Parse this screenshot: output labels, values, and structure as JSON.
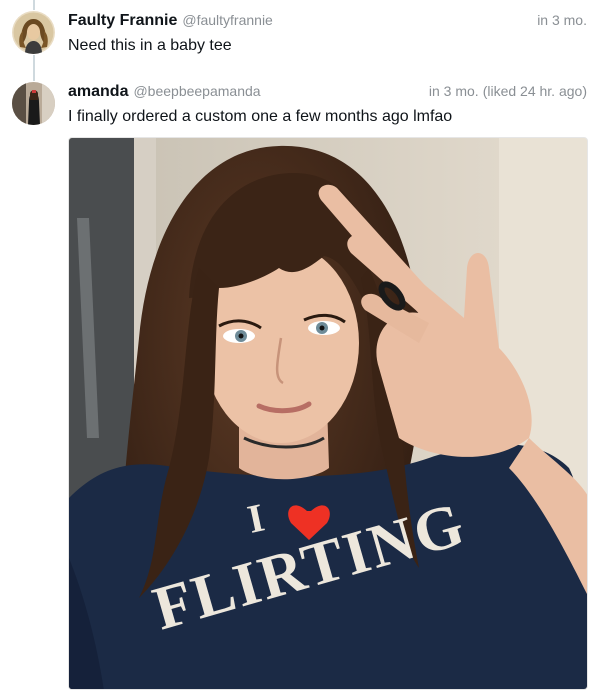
{
  "posts": [
    {
      "display_name": "Faulty Frannie",
      "handle": "@faultyfrannie",
      "time": "in 3 mo.",
      "text": "Need this in a baby tee"
    },
    {
      "display_name": "amanda",
      "handle": "@beepbeepamanda",
      "time": "in 3 mo.",
      "liked": "(liked 24 hr. ago)",
      "text": "I finally ordered a custom one a few months ago lmfao",
      "photo": {
        "shirt_text_line1": "I",
        "shirt_text_line2": "FLIRTING",
        "shirt_color": "#1b2a45",
        "heart_color": "#ee3124",
        "print_color": "#ede7dc"
      }
    }
  ],
  "colors": {
    "muted": "#8a8f94",
    "text": "#0f1419",
    "thread_line": "#cfd9de"
  }
}
